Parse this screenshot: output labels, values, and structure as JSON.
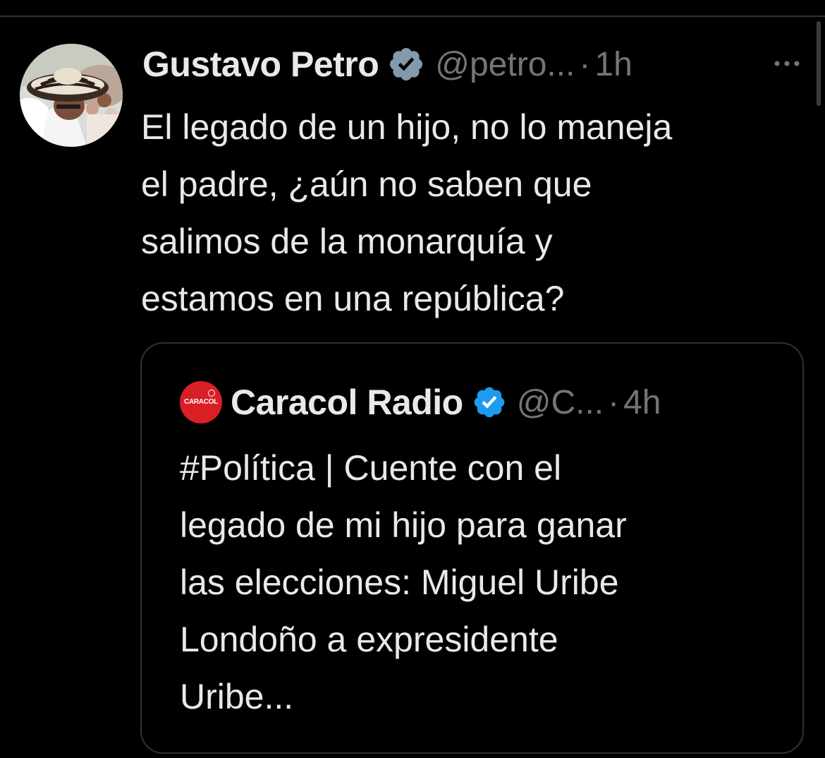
{
  "tweet": {
    "author_name": "Gustavo Petro",
    "handle": "@petro...",
    "separator": "·",
    "time": "1h",
    "more_icon": "more-horizontal-icon",
    "verified_icon": "verified-badge-icon",
    "text": "El legado de un hijo, no lo maneja\nel padre, ¿aún no saben que\nsalimos de la monarquía y\nestamos en una república?"
  },
  "quote": {
    "author_name": "Caracol Radio",
    "handle": "@C...",
    "separator": "·",
    "time": "4h",
    "logo_text": "CARACOL",
    "text": "#Política | Cuente con el\nlegado de mi hijo para ganar\nlas elecciones: Miguel Uribe\nLondoño a expresidente\nUribe..."
  },
  "colors": {
    "background": "#000000",
    "text_primary": "#e7e9ea",
    "text_secondary": "#71767b",
    "border": "#2f3336",
    "verified_blue": "#1d9bf0",
    "verified_gray": "#829aab",
    "caracol_red": "#d81f26"
  }
}
